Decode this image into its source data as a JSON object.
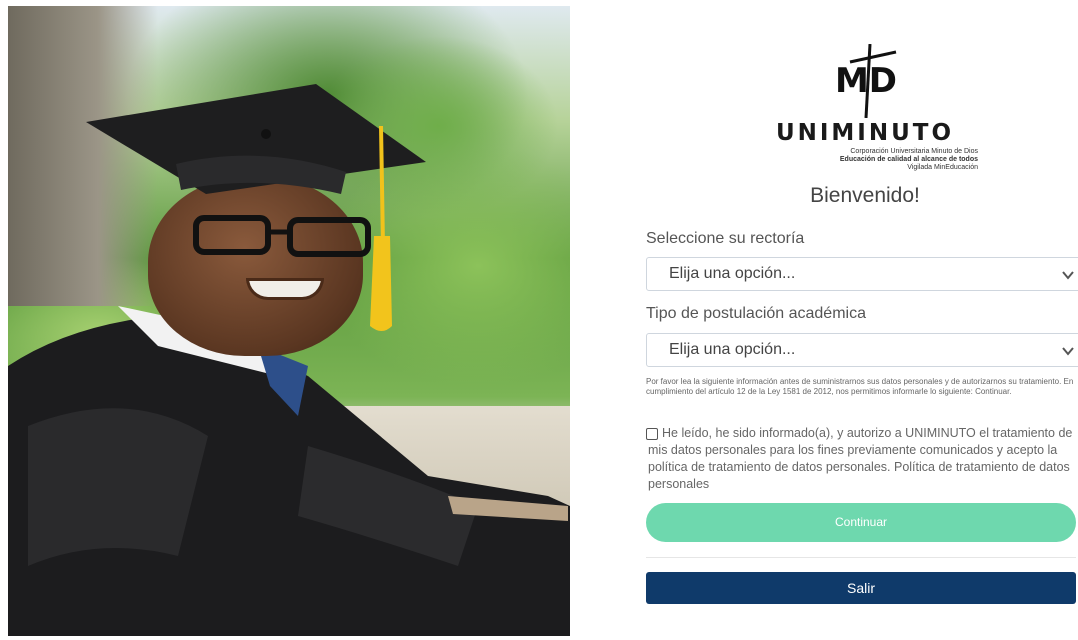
{
  "photo": {
    "description_icon": "graduate-photo"
  },
  "logo": {
    "mark_text": "MD",
    "brand": "UNIMINUTO",
    "line1": "Corporación Universitaria Minuto de Dios",
    "line2": "Educación de calidad al alcance de todos",
    "line3": "Vigilada MinEducación"
  },
  "heading": "Bienvenido!",
  "rectoria": {
    "label": "Seleccione su rectoría",
    "selected": "Elija una opción..."
  },
  "postulacion": {
    "label": "Tipo de postulación académica",
    "selected": "Elija una opción..."
  },
  "notice": "Por favor lea la siguiente información antes de suministrarnos sus datos personales y de autorizarnos su tratamiento. En cumplimiento del artículo 12 de la Ley 1581 de 2012, nos permitimos informarle lo siguiente: Continuar.",
  "consent": {
    "checked": false,
    "text": "He leído, he sido informado(a), y autorizo a UNIMINUTO el tratamiento de mis datos personales para los fines previamente comunicados y acepto la política de tratamiento de datos personales. Política de tratamiento de datos personales"
  },
  "buttons": {
    "continue": "Continuar",
    "exit": "Salir"
  },
  "colors": {
    "continue_bg": "#6ed8ae",
    "exit_bg": "#0f3a6a"
  }
}
